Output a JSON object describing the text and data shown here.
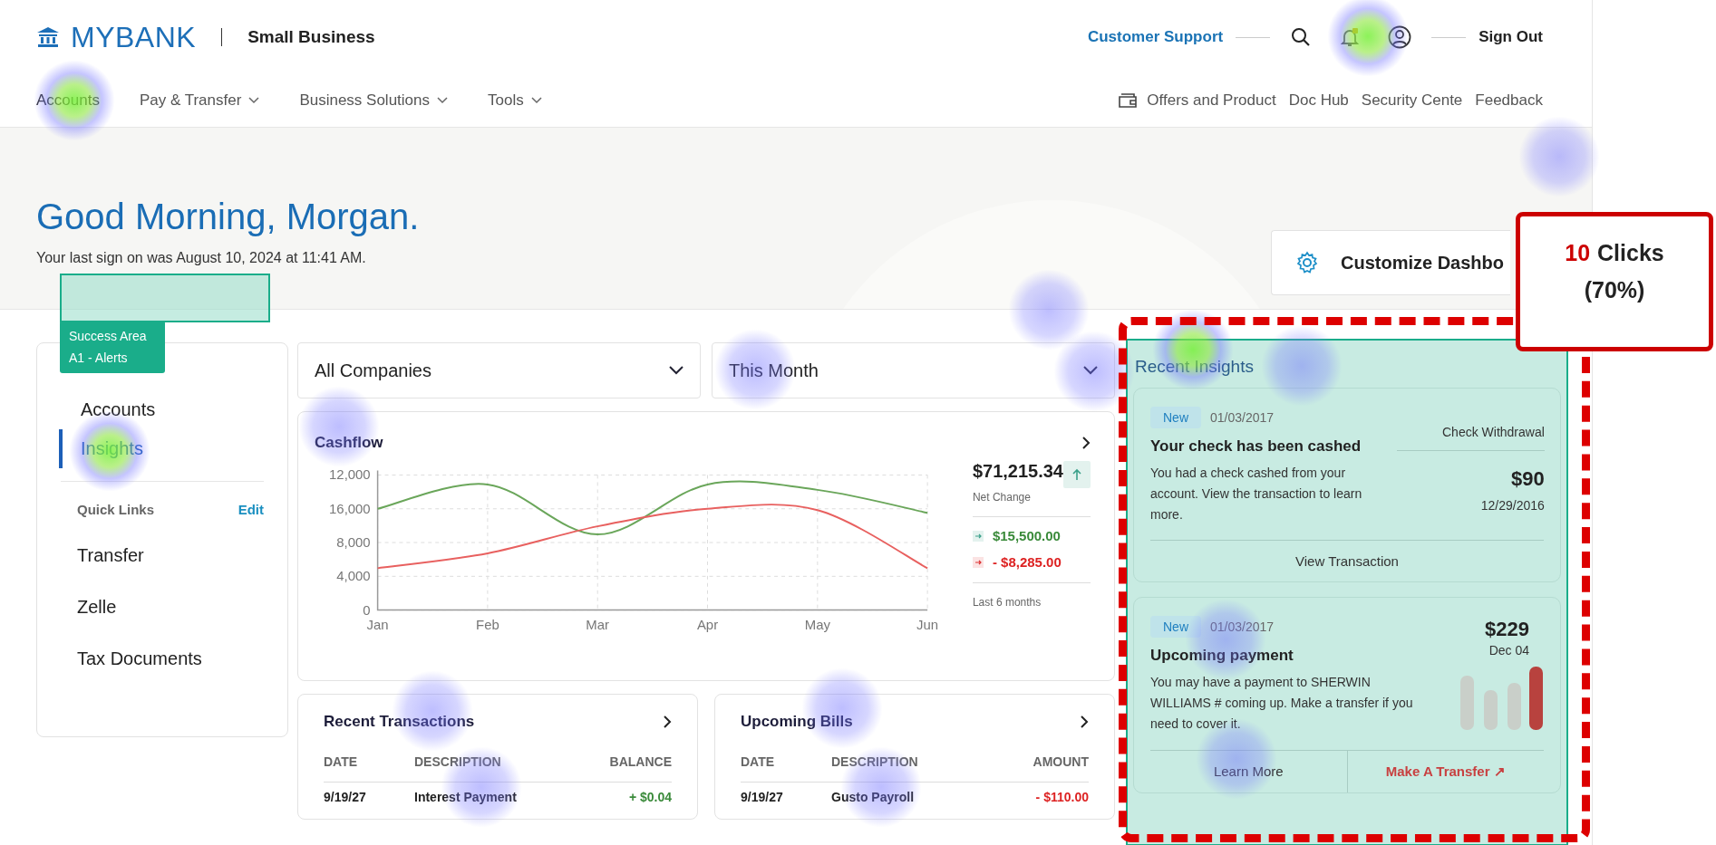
{
  "header": {
    "logo": "MYBANK",
    "segment": "Small Business",
    "support_link": "Customer Support",
    "sign_out": "Sign Out"
  },
  "nav": [
    {
      "label": "Accounts",
      "dropdown": false,
      "selected": true
    },
    {
      "label": "Pay & Transfer",
      "dropdown": true,
      "selected": false
    },
    {
      "label": "Business Solutions",
      "dropdown": true,
      "selected": false
    },
    {
      "label": "Tools",
      "dropdown": true,
      "selected": false
    }
  ],
  "nav_right": [
    {
      "label": "Offers and Product",
      "icon": true
    },
    {
      "label": "Doc Hub",
      "icon": false
    },
    {
      "label": "Security Cente",
      "icon": false
    },
    {
      "label": "Feedback",
      "icon": false
    }
  ],
  "hero": {
    "greeting": "Good Morning, Morgan.",
    "last_sign_on": "Your last sign on was August 10, 2024 at 11:41 AM.",
    "customize_button": "Customize Dashbo"
  },
  "sidebar": {
    "items": [
      {
        "label": "Accounts",
        "selected": false
      },
      {
        "label": "Insights",
        "selected": true
      }
    ],
    "quick_links_title": "Quick Links",
    "edit": "Edit",
    "quick_links": [
      "Transfer",
      "Zelle",
      "Tax Documents"
    ]
  },
  "filters": [
    {
      "value": "All Companies"
    },
    {
      "value": "This Month"
    }
  ],
  "cashflow": {
    "title": "Cashflow",
    "net_amount": "$71,215.34",
    "net_label": "Net Change",
    "income": "$15,500.00",
    "expense": "- $8,285.00",
    "period": "Last 6 months",
    "y_axis_labels": [
      "12,000",
      "16,000",
      "8,000",
      "4,000",
      "0"
    ],
    "x_axis_labels": [
      "Jan",
      "Feb",
      "Mar",
      "Apr",
      "May",
      "Jun"
    ]
  },
  "tables": [
    {
      "title": "Recent Transactions",
      "columns": [
        "DATE",
        "DESCRIPTION",
        "BALANCE"
      ],
      "rows": [
        {
          "cells": [
            "9/19/27",
            "Interest Payment",
            "+ $0.04"
          ],
          "kind": "credit"
        }
      ]
    },
    {
      "title": "Upcoming Bills",
      "columns": [
        "DATE",
        "DESCRIPTION",
        "AMOUNT"
      ],
      "rows": [
        {
          "cells": [
            "9/19/27",
            "Gusto Payroll",
            "- $110.00"
          ],
          "kind": "debit"
        }
      ]
    }
  ],
  "insights": {
    "title": "Recent Insights",
    "cards": [
      {
        "kind": "transaction",
        "badge": "New",
        "date": "01/03/2017",
        "title": "Your check has been cashed",
        "body": "You had a check cashed from your account. View the transaction to learn more.",
        "category": "Check Withdrawal",
        "amount": "$90",
        "amount_date": "12/29/2016",
        "actions": [
          "View Transaction"
        ]
      },
      {
        "kind": "payment",
        "badge": "New",
        "date": "01/03/2017",
        "title": "Upcoming payment",
        "body": "You may have a payment to SHERWIN WILLIAMS # coming up. Make a transfer if you need to cover it.",
        "amount": "$229",
        "amount_date": "Dec 04",
        "actions": [
          "Learn More",
          "Make A Transfer ↗"
        ]
      }
    ]
  },
  "annotation": {
    "success_area": [
      "Success Area",
      "A1 - Alerts"
    ],
    "clicks": "10",
    "clicks_label": "Clicks",
    "percent": "(70%)"
  }
}
